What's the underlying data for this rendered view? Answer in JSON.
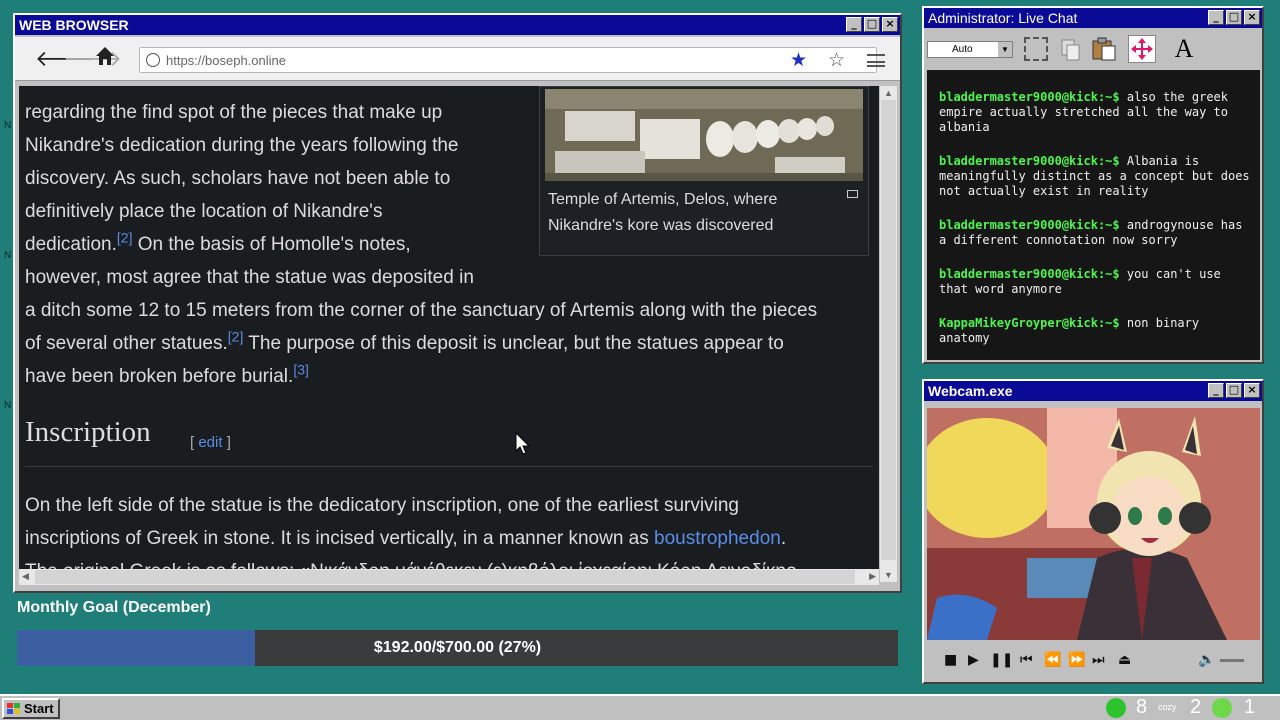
{
  "browser": {
    "title": "WEB BROWSER",
    "url": "https://boseph.online",
    "article": {
      "para1_lines": [
        "regarding the find spot of the pieces that make up",
        "Nikandre's dedication during the years following the",
        "discovery. As such, scholars have not been able to",
        "definitively place the location of Nikandre's"
      ],
      "para1_line5a": "dedication.",
      "ref2": "[2]",
      "para1_line5b": " On the basis of Homolle's notes,",
      "para1_line6": "however, most agree that the statue was deposited in",
      "para1_line7": "a ditch some 12 to 15 meters from the corner of the sanctuary of Artemis along with the pieces",
      "para1_line8a": "of several other statues.",
      "ref2b": "[2]",
      "para1_line8b": " The purpose of this deposit is unclear, but the statues appear to",
      "para1_line9": "have been broken before burial.",
      "ref3": "[3]",
      "figure_caption": "Temple of Artemis, Delos, where Nikandre's kore was discovered",
      "heading": "Inscription",
      "edit_open": "[ ",
      "edit_label": "edit",
      "edit_close": " ]",
      "para2_line1": "On the left side of the statue is the dedicatory inscription, one of the earliest surviving",
      "para2_line2a": "inscriptions of Greek in stone. It is incised vertically, in a manner known as ",
      "para2_link": "boustrophedon",
      "para2_line2b": ".",
      "para2_line3": "The original Greek is as follows: «Νικάνδρη μάνέθεκεν (ε)κηβόλοι ἰοχεαίρηι Κόρη Δεινοδίκηο"
    }
  },
  "goal": {
    "title": "Monthly Goal (December)",
    "text": "$192.00/$700.00 (27%)",
    "progress": 0.27
  },
  "chat": {
    "title": "Administrator: Live Chat",
    "font_select": "Auto",
    "messages": [
      {
        "user": "bladdermaster9000@kick:~$",
        "text": " also the greek empire actually stretched all the way to albania"
      },
      {
        "user": "bladdermaster9000@kick:~$",
        "text": " Albania is meaningfully distinct as a concept but does not actually exist in reality"
      },
      {
        "user": "bladdermaster9000@kick:~$",
        "text": " androgynouse has a different connotation now sorry"
      },
      {
        "user": "bladdermaster9000@kick:~$",
        "text": " you can't use that word anymore"
      },
      {
        "user": "KappaMikeyGroyper@kick:~$",
        "text": " non binary anatomy"
      }
    ]
  },
  "webcam": {
    "title": "Webcam.exe"
  },
  "taskbar": {
    "start_label": "Start",
    "tray_count1": "8",
    "tray_count2": "2",
    "tray_count3": "1",
    "tray_small_label": "cozy"
  }
}
